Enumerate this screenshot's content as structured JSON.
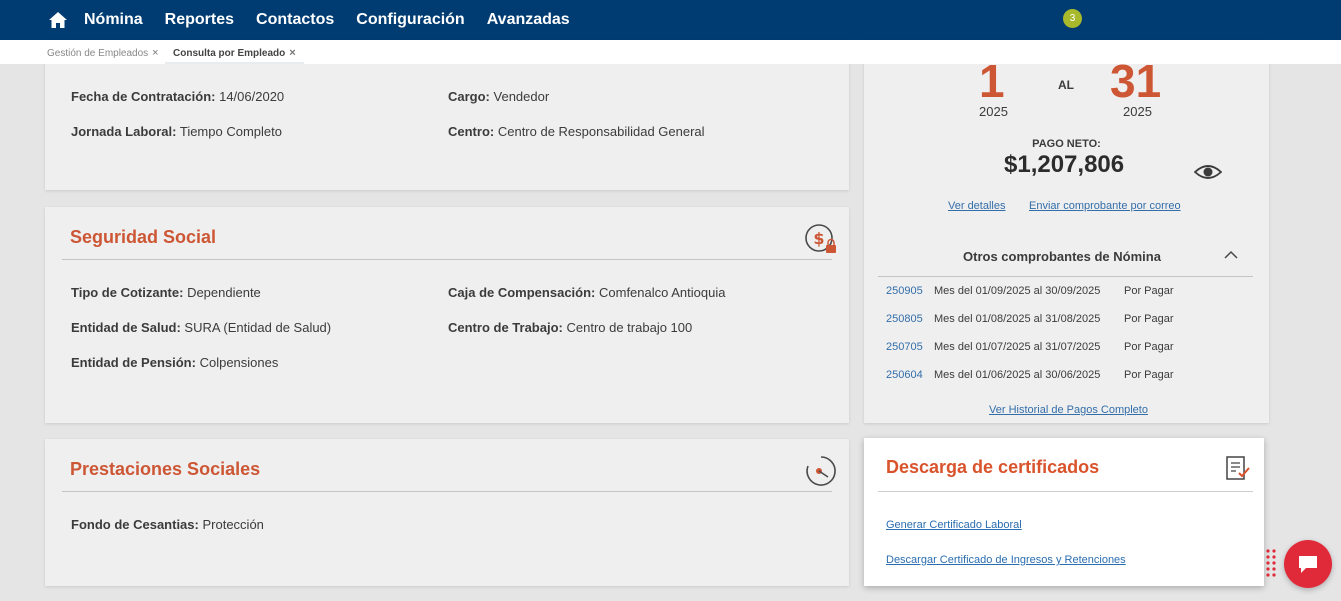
{
  "nav": {
    "items": [
      "Nómina",
      "Reportes",
      "Contactos",
      "Configuración",
      "Avanzadas"
    ],
    "notification_count": "3"
  },
  "tabs": [
    {
      "label": "Gestión de Empleados",
      "close": "×"
    },
    {
      "label": "Consulta por Empleado",
      "close": "×"
    }
  ],
  "empleo": {
    "fecha_contratacion": {
      "label": "Fecha de Contratación:",
      "value": "14/06/2020"
    },
    "jornada_laboral": {
      "label": "Jornada Laboral:",
      "value": "Tiempo Completo"
    },
    "cargo": {
      "label": "Cargo:",
      "value": "Vendedor"
    },
    "centro": {
      "label": "Centro:",
      "value": "Centro de Responsabilidad General"
    }
  },
  "seguridad_social": {
    "title": "Seguridad Social",
    "tipo_cotizante": {
      "label": "Tipo de Cotizante:",
      "value": "Dependiente"
    },
    "entidad_salud": {
      "label": "Entidad de Salud:",
      "value": "SURA (Entidad de Salud)"
    },
    "entidad_pension": {
      "label": "Entidad de Pensión:",
      "value": "Colpensiones"
    },
    "caja_compensacion": {
      "label": "Caja de Compensación:",
      "value": "Comfenalco Antioquia"
    },
    "centro_trabajo": {
      "label": "Centro de Trabajo:",
      "value": "Centro de trabajo 100"
    }
  },
  "prestaciones": {
    "title": "Prestaciones Sociales",
    "fondo_cesantias": {
      "label": "Fondo de Cesantias:",
      "value": "Protección"
    }
  },
  "pago": {
    "dia_inicio": "1",
    "dia_fin": "31",
    "al": "AL",
    "anio_inicio": "2025",
    "anio_fin": "2025",
    "pago_neto_label": "PAGO NETO:",
    "pago_neto_value": "$1,207,806",
    "ver_detalles": "Ver detalles",
    "enviar_comprobante": "Enviar comprobante por correo",
    "otros_title": "Otros comprobantes de Nómina",
    "comprobantes": [
      {
        "code": "250905",
        "desc": "Mes del 01/09/2025 al 30/09/2025",
        "status": "Por Pagar"
      },
      {
        "code": "250805",
        "desc": "Mes del 01/08/2025 al 31/08/2025",
        "status": "Por Pagar"
      },
      {
        "code": "250705",
        "desc": "Mes del 01/07/2025 al 31/07/2025",
        "status": "Por Pagar"
      },
      {
        "code": "250604",
        "desc": "Mes del 01/06/2025 al 30/06/2025",
        "status": "Por Pagar"
      }
    ],
    "historial_link": "Ver Historial de Pagos Completo"
  },
  "certificados": {
    "title": "Descarga de certificados",
    "laboral_link": "Generar Certificado Laboral",
    "ingresos_link": "Descargar Certificado de Ingresos y Retenciones"
  },
  "colors": {
    "nav_bg": "#003b71",
    "accent": "#d9532c",
    "link": "#2a6db0",
    "badge": "#a9b92c",
    "chat": "#e02a3a"
  }
}
